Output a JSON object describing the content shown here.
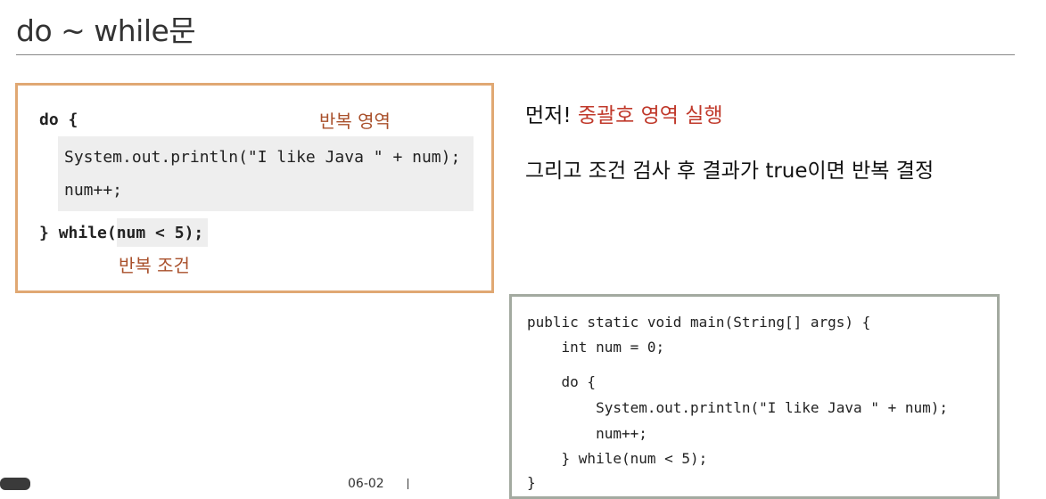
{
  "title": "do ~ while문",
  "left_box": {
    "do_keyword": "do {",
    "area_label": "반복 영역",
    "body_lines": [
      "System.out.println(\"I like Java \" + num);",
      "num++;"
    ],
    "close_brace": "}",
    "while_keyword": "while",
    "condition": "(num < 5);",
    "condition_label": "반복 조건"
  },
  "explanation": {
    "line1_prefix": "먼저! ",
    "line1_highlight": "중괄호 영역 실행",
    "line2": "그리고 조건 검사 후 결과가 true이면 반복 결정"
  },
  "code_example": {
    "lines": [
      "public static void main(String[] args) {",
      "    int num = 0;",
      "    do {",
      "        System.out.println(\"I like Java \" + num);",
      "        num++;",
      "    } while(num < 5);",
      "}"
    ]
  },
  "footer": {
    "page_number": "06-02"
  },
  "colors": {
    "accent_orange": "#e0a873",
    "label_brown": "#a9502b",
    "highlight_red": "#c0392b",
    "code_box_border": "#a3aaa0"
  }
}
